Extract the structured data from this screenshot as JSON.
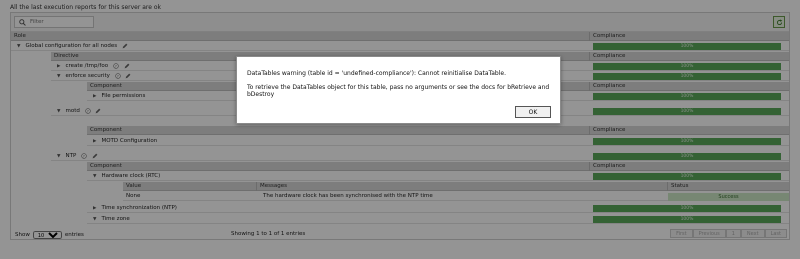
{
  "top_message": "All the last execution reports for this server are ok",
  "filter": {
    "placeholder": "Filter"
  },
  "table": {
    "col_role": "Role",
    "col_compliance": "Compliance",
    "col_directive": "Directive",
    "col_component": "Component",
    "col_value": "Value",
    "col_messages": "Messages",
    "col_status": "Status",
    "global_label": "Global configuration for all nodes",
    "compliance_value": "100%",
    "directives": {
      "create": "create /tmp/foo",
      "enforce": "enforce security",
      "motd": "motd",
      "ntp": "NTP"
    },
    "components": {
      "file_permissions": "File permissions",
      "motd_configuration": "MOTD Configuration",
      "hardware_clock": "Hardware clock (RTC)",
      "time_sync": "Time synchronization (NTP)",
      "time_zone": "Time zone"
    },
    "detail_row": {
      "value": "None",
      "message": "The hardware clock has been synchronised with the NTP time",
      "status": "Success"
    }
  },
  "footer": {
    "show_label": "Show",
    "entries_value": "10",
    "entries_label": "entries",
    "info": "Showing 1 to 1 of 1 entries",
    "pager": {
      "first": "First",
      "previous": "Previous",
      "page": "1",
      "next": "Next",
      "last": "Last"
    }
  },
  "dialog": {
    "line1": "DataTables warning (table id = 'undefined-compliance'): Cannot reinitialise DataTable.",
    "line2": "To retrieve the DataTables object for this table, pass no arguments or see the docs for bRetrieve and bDestroy",
    "ok_label": "OK"
  },
  "colors": {
    "compliance_green": "#5aa95a",
    "success_green": "#cde8c6",
    "header_gray": "#d7d7d7"
  }
}
